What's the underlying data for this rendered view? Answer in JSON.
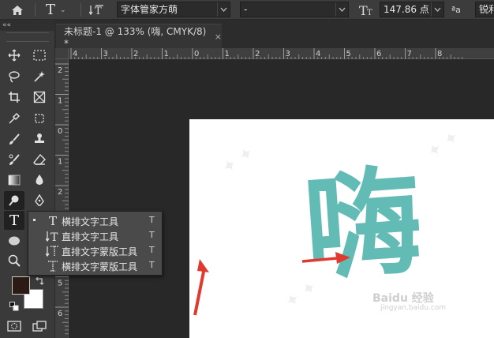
{
  "options_bar": {
    "home_icon": "home-icon",
    "tool_icon": "horizontal-type-icon",
    "orientation_icon": "text-orientation-icon",
    "font_family": "字体管家方萌",
    "font_style": "-",
    "size_icon": "font-size-icon",
    "font_size": "147.86 点",
    "aa_icon": "anti-alias-icon",
    "antialias_value": "锐利"
  },
  "panel_collapse_label": "««",
  "document_tab": {
    "title": "未标题-1 @ 133% (嗨, CMYK/8) *",
    "close_glyph": "×"
  },
  "ruler_top": {
    "labels": [
      "4",
      "3",
      "2",
      "1",
      "0",
      "1",
      "2",
      "3",
      "4",
      "5",
      "6",
      "7",
      "8"
    ]
  },
  "ruler_left": {
    "labels": [
      "2",
      "1",
      "0",
      "1",
      "2",
      "3",
      "4",
      "5",
      "6"
    ]
  },
  "canvas": {
    "text": "嗨",
    "text_color": "#62bcb5",
    "watermark_logo": "Baidu 经验",
    "watermark_url": "jingyan.baidu.com"
  },
  "flyout": {
    "items": [
      {
        "label": "横排文字工具",
        "key": "T",
        "icon": "horizontal-type-icon",
        "selected": true
      },
      {
        "label": "直排文字工具",
        "key": "T",
        "icon": "vertical-type-icon",
        "selected": false
      },
      {
        "label": "直排文字蒙版工具",
        "key": "T",
        "icon": "vertical-type-mask-icon",
        "selected": false
      },
      {
        "label": "横排文字蒙版工具",
        "key": "T",
        "icon": "horizontal-type-mask-icon",
        "selected": false
      }
    ]
  },
  "colors": {
    "foreground": "#2b1b14",
    "background": "#ffffff",
    "arrow": "#e03a2f"
  }
}
